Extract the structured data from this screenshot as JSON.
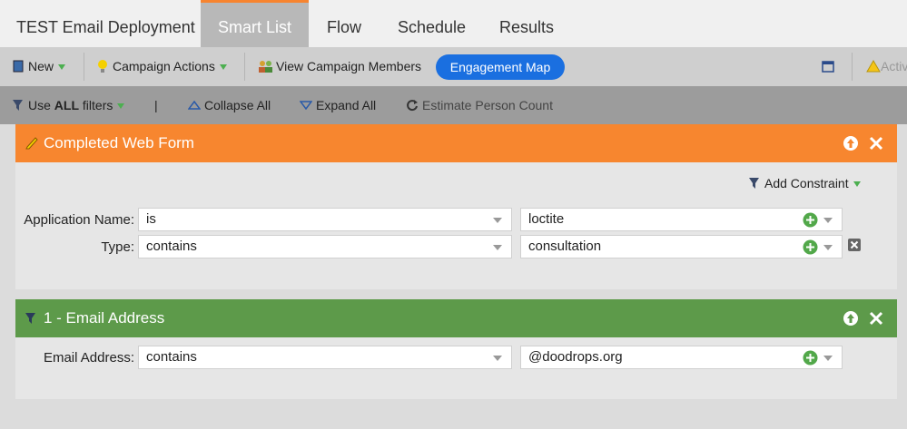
{
  "tabs": [
    "TEST Email Deployment",
    "Smart List",
    "Flow",
    "Schedule",
    "Results"
  ],
  "toolbar": {
    "new_label": "New",
    "campaign_actions_label": "Campaign Actions",
    "view_members_label": "View Campaign Members",
    "engagement_map_label": "Engagement Map",
    "active_label": "Activ"
  },
  "filter_bar": {
    "use_prefix": "Use ",
    "use_bold": "ALL",
    "use_suffix": " filters",
    "divider": "|",
    "collapse_label": "Collapse All",
    "expand_label": "Expand All",
    "estimate_label": "Estimate Person Count"
  },
  "filter1": {
    "title": "Completed Web Form",
    "header_color": "#f7862f",
    "add_constraint_label": "Add Constraint",
    "rows": [
      {
        "label": "Application Name:",
        "operator": "is",
        "value": "loctite"
      },
      {
        "label": "Type:",
        "operator": "contains",
        "value": "consultation"
      }
    ]
  },
  "filter2": {
    "title": "1 - Email Address",
    "header_color": "#5d9a4a",
    "rows": [
      {
        "label": "Email Address:",
        "operator": "contains",
        "value": "@doodrops.org"
      }
    ]
  },
  "colors": {
    "accent_orange": "#f7842f",
    "button_blue": "#1a6fe0",
    "green_plus": "#52a84a"
  }
}
